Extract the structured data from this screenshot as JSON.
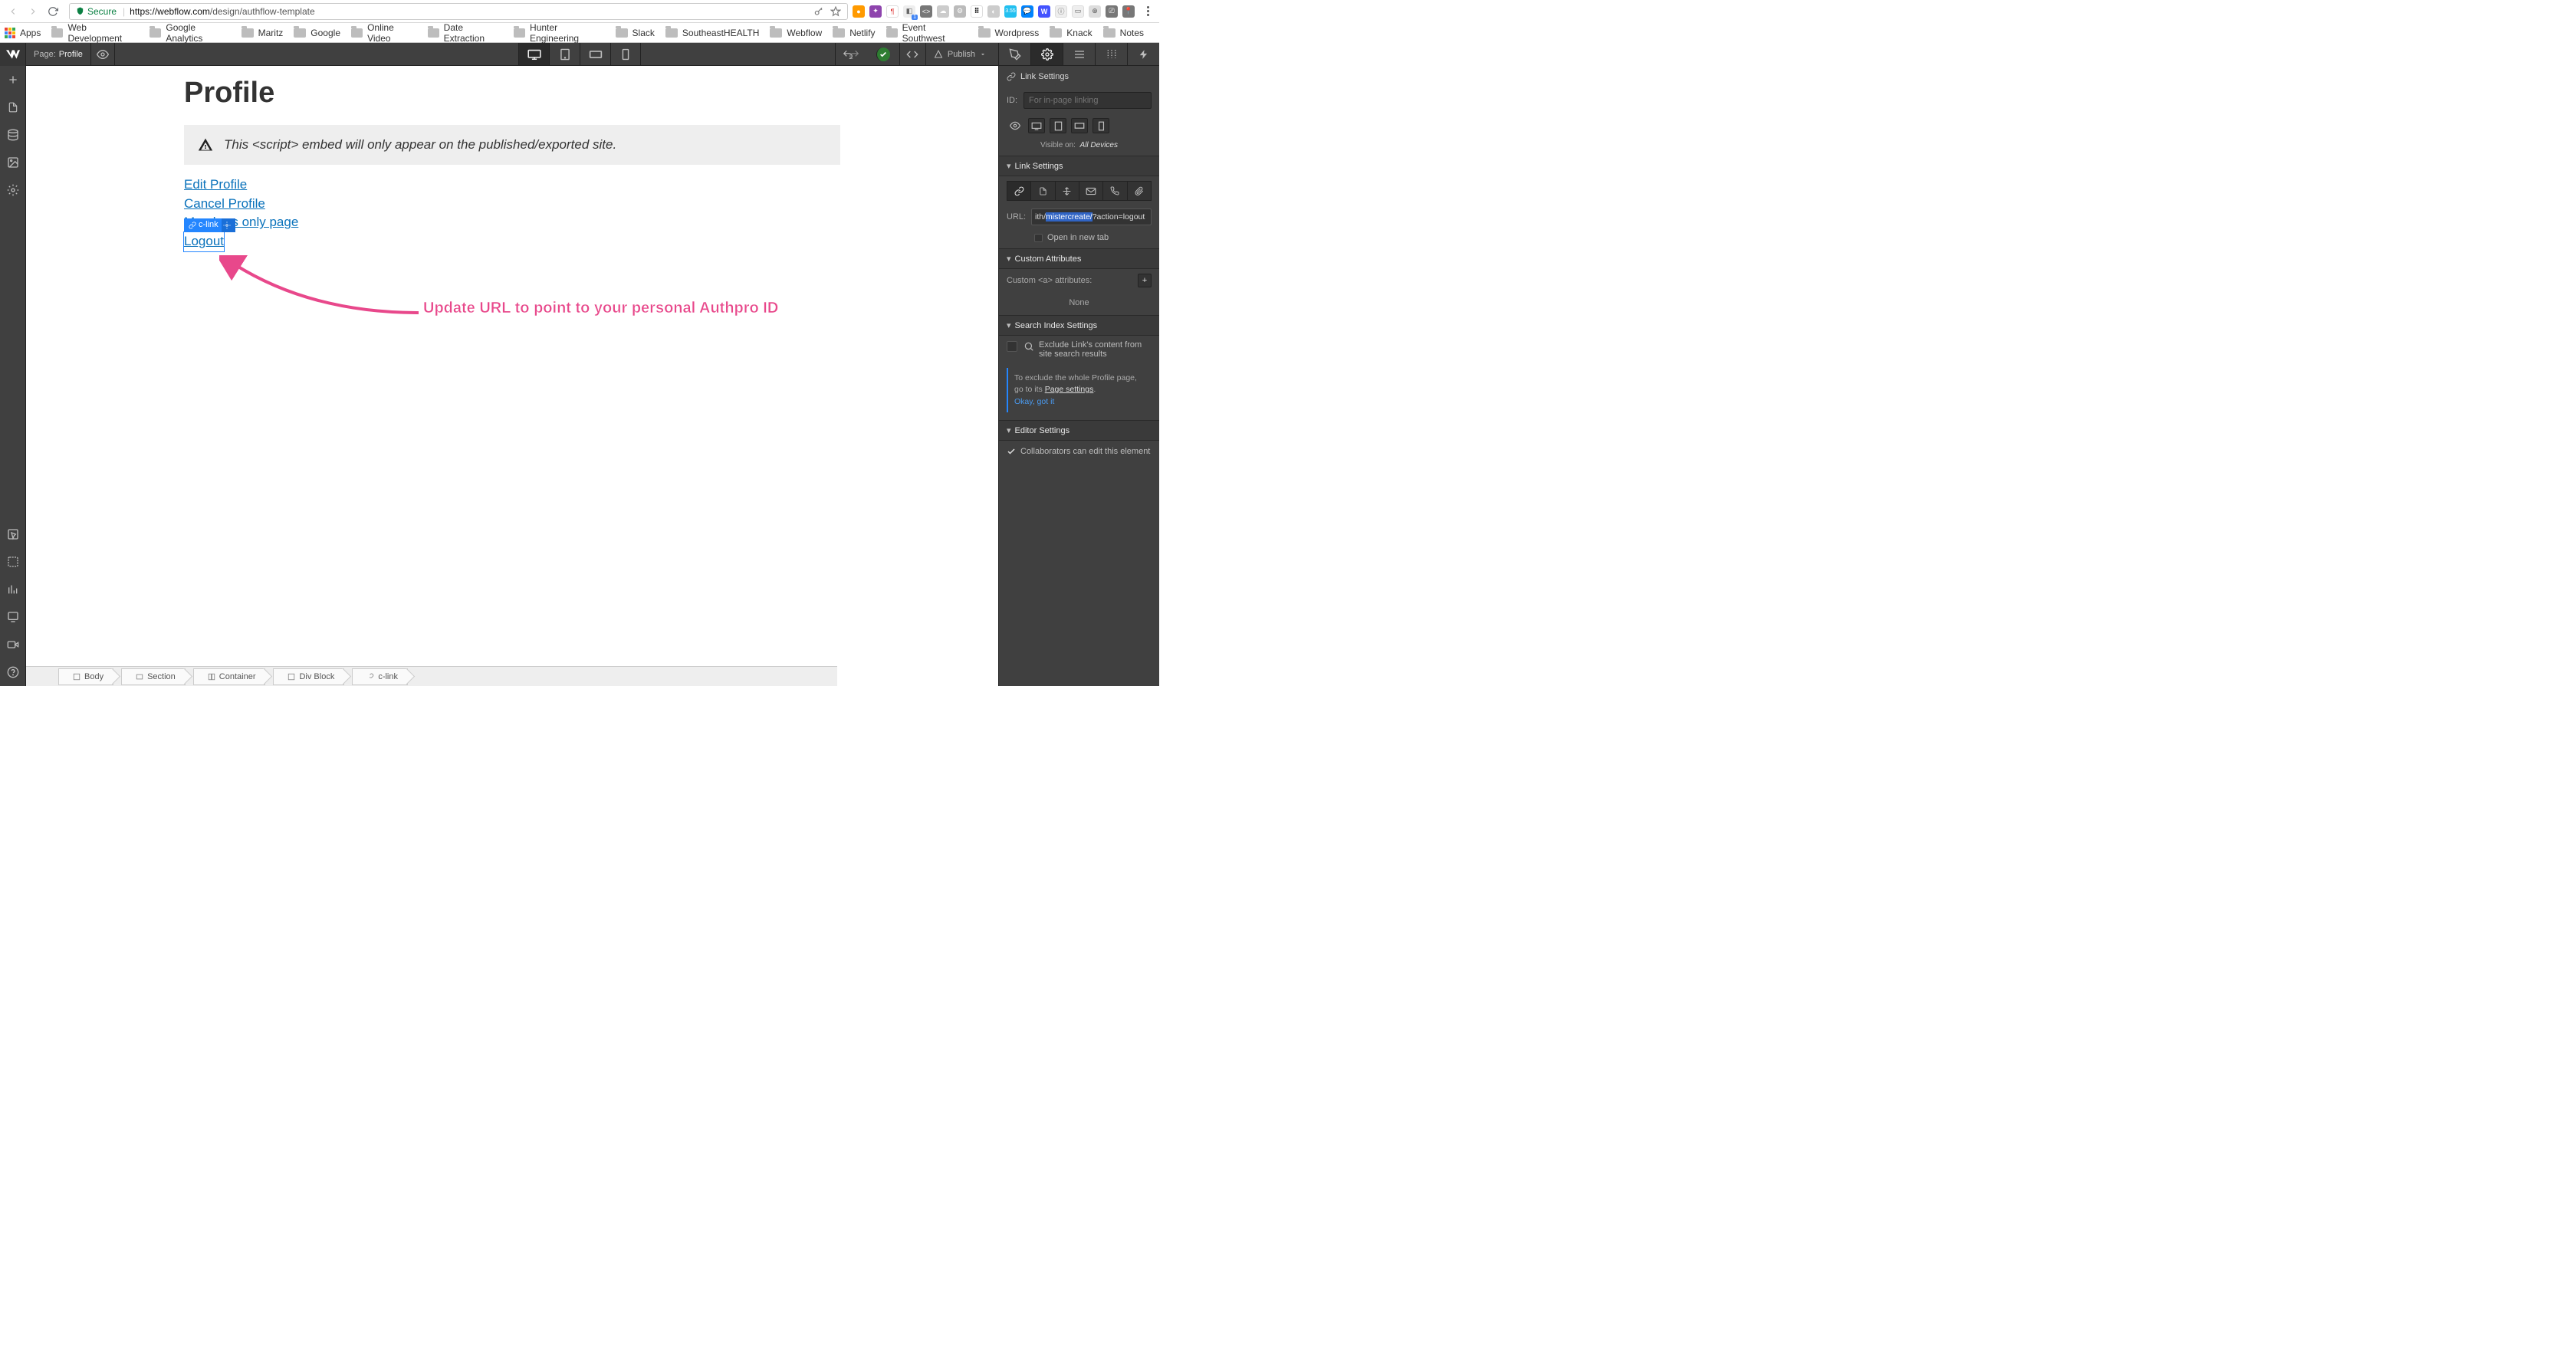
{
  "chrome": {
    "secure_label": "Secure",
    "url_host": "https://webflow.com",
    "url_path": "/design/authflow-template",
    "bookmarks": [
      "Apps",
      "Web Development",
      "Google Analytics",
      "Maritz",
      "Google",
      "Online Video",
      "Date Extraction",
      "Hunter Engineering",
      "Slack",
      "SoutheastHEALTH",
      "Webflow",
      "Netlify",
      "Event Southwest",
      "Wordpress",
      "Knack",
      "Notes"
    ],
    "ext_badge": "3.55"
  },
  "topbar": {
    "page_prefix": "Page:",
    "page_name": "Profile",
    "publish_label": "Publish"
  },
  "canvas": {
    "heading": "Profile",
    "embed_notice": "This <script> embed will only appear on the published/exported site.",
    "links": [
      "Edit Profile",
      "Cancel Profile",
      "Members only page",
      "Logout"
    ],
    "selection_tag": "c-link"
  },
  "annotation": "Update URL to point to your personal Authpro ID",
  "panel": {
    "title1": "Link Settings",
    "id_label": "ID:",
    "id_placeholder": "For in-page linking",
    "visible_prefix": "Visible on:",
    "visible_value": "All Devices",
    "section_link": "Link Settings",
    "url_label": "URL:",
    "url_pre": "ith/",
    "url_hl": "mistercreate/",
    "url_post": "?action=logout",
    "open_new_tab": "Open in new tab",
    "section_attrs": "Custom Attributes",
    "attrs_label": "Custom <a> attributes:",
    "attrs_none": "None",
    "section_search": "Search Index Settings",
    "search_exclude": "Exclude Link's content from site search results",
    "search_tip_1": "To exclude the whole Profile page, go to its ",
    "search_tip_link": "Page settings",
    "search_tip_ok": "Okay, got it",
    "section_editor": "Editor Settings",
    "editor_collab": "Collaborators can edit this element"
  },
  "breadcrumb": [
    "Body",
    "Section",
    "Container",
    "Div Block",
    "c-link"
  ]
}
